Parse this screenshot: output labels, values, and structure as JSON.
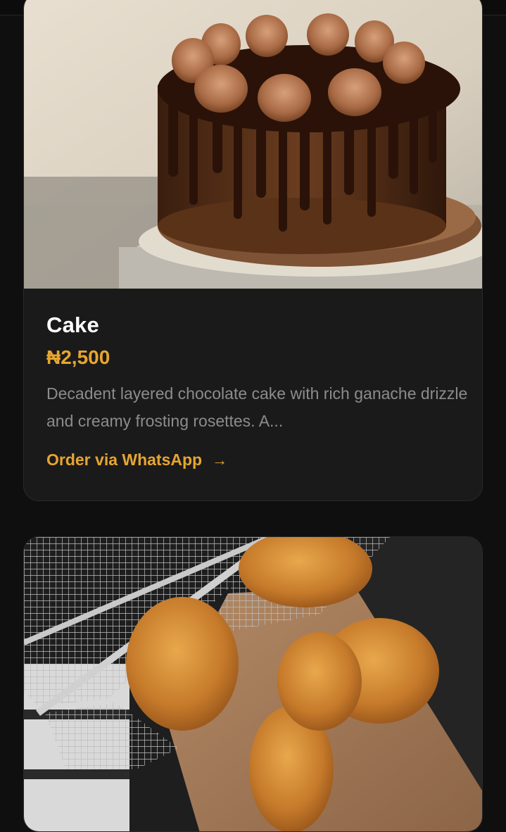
{
  "products": [
    {
      "title": "Cake",
      "price": "₦2,500",
      "description": "Decadent layered chocolate cake with rich ganache drizzle and creamy frosting rosettes. A...",
      "order_label": "Order via WhatsApp",
      "arrow": "→"
    }
  ],
  "colors": {
    "background": "#0f0f0f",
    "card": "#1a1a1a",
    "accent": "#e6a531",
    "title": "#ffffff",
    "description": "#8c8c8c"
  }
}
